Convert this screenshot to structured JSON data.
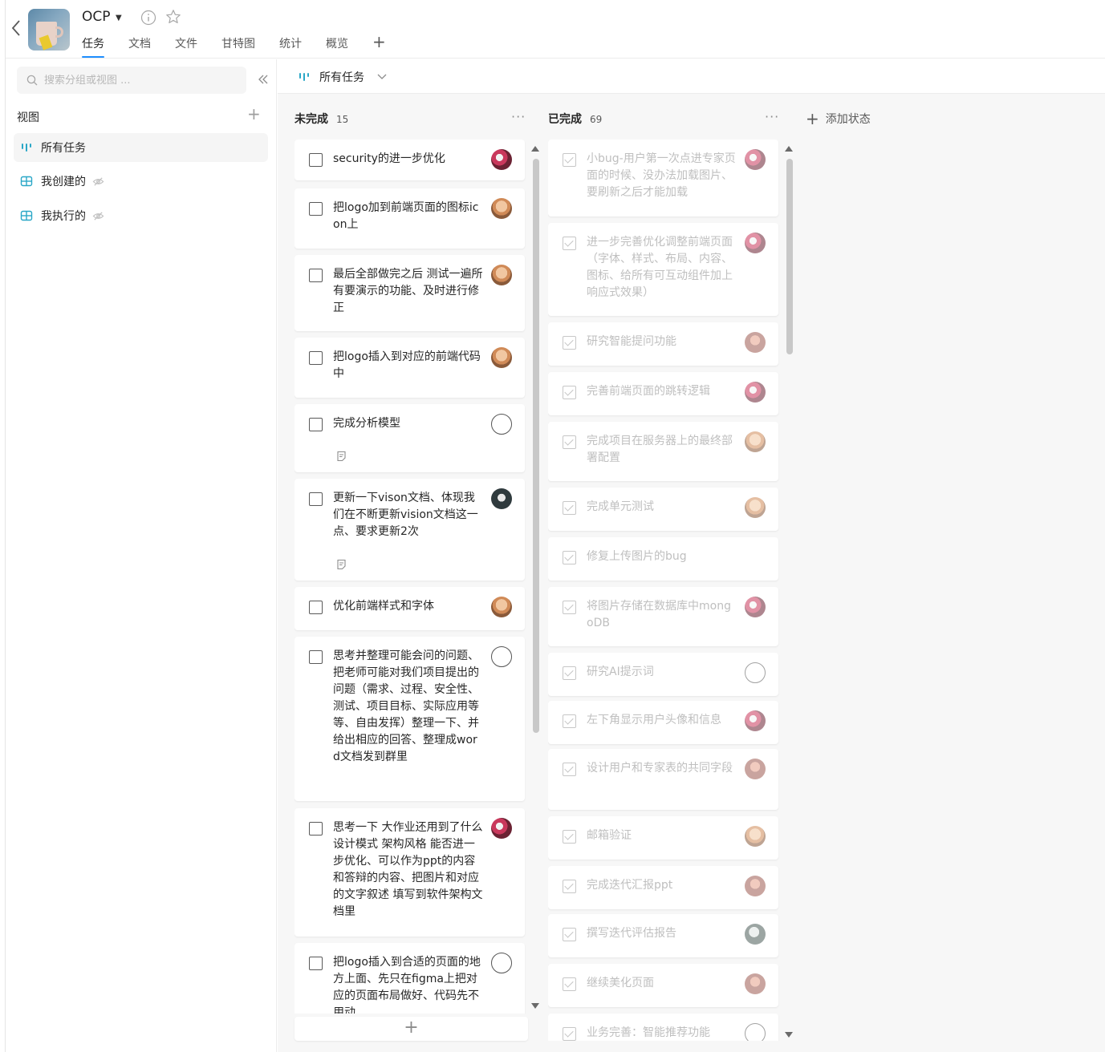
{
  "project": {
    "name": "OCP"
  },
  "tabs": [
    "任务",
    "文档",
    "文件",
    "甘特图",
    "统计",
    "概览"
  ],
  "sidebar": {
    "search_placeholder": "搜索分组或视图 ...",
    "views_title": "视图",
    "items": [
      {
        "label": "所有任务",
        "icon": "board-view-icon",
        "active": true
      },
      {
        "label": "我创建的",
        "icon": "table-view-icon",
        "hidden": true
      },
      {
        "label": "我执行的",
        "icon": "table-view-icon",
        "hidden": true
      }
    ]
  },
  "viewbar": {
    "current": "所有任务"
  },
  "columns": [
    {
      "name": "未完成",
      "count": "15",
      "cards": [
        {
          "title": "security的进一步优化",
          "avatar": "av-a"
        },
        {
          "title": "把logo加到前端页面的图标icon上",
          "avatar": "av-b"
        },
        {
          "title": "最后全部做完之后 测试一遍所有要演示的功能、及时进行修正",
          "avatar": "av-b"
        },
        {
          "title": "把logo插入到对应的前端代码中",
          "avatar": "av-b"
        },
        {
          "title": "完成分析模型",
          "avatar": "av-c",
          "note": true
        },
        {
          "title": "更新一下vison文档、体现我们在不断更新vision文档这一点、要求更新2次",
          "avatar": "av-d",
          "note": true
        },
        {
          "title": "优化前端样式和字体",
          "avatar": "av-b"
        },
        {
          "title": "思考并整理可能会问的问题、把老师可能对我们项目提出的问题（需求、过程、安全性、测试、项目目标、实际应用等等、自由发挥）整理一下、并给出相应的回答、整理成word文档发到群里",
          "avatar": "av-c"
        },
        {
          "title": "思考一下 大作业还用到了什么设计模式 架构风格 能否进一步优化、可以作为ppt的内容和答辩的内容、把图片和对应的文字叙述 填写到软件架构文档里",
          "avatar": "av-a"
        },
        {
          "title": "把logo插入到合适的页面的地方上面、先只在figma上把对应的页面布局做好、代码先不用动",
          "avatar": "av-c"
        }
      ]
    },
    {
      "name": "已完成",
      "count": "69",
      "cards": [
        {
          "title": "小bug-用户第一次点进专家页面的时候、没办法加载图片、要刷新之后才能加载",
          "avatar": "av-a"
        },
        {
          "title": "进一步完善优化调整前端页面（字体、样式、布局、内容、图标、给所有可互动组件加上响应式效果）",
          "avatar": "av-a"
        },
        {
          "title": "研究智能提问功能",
          "avatar": "av-e"
        },
        {
          "title": "完善前端页面的跳转逻辑",
          "avatar": "av-a"
        },
        {
          "title": "完成项目在服务器上的最终部署配置",
          "avatar": "av-b"
        },
        {
          "title": "完成单元测试",
          "avatar": "av-b"
        },
        {
          "title": "修复上传图片的bug",
          "avatar": ""
        },
        {
          "title": "将图片存储在数据库中mongoDB",
          "avatar": "av-a"
        },
        {
          "title": "研究AI提示词",
          "avatar": "av-c"
        },
        {
          "title": "左下角显示用户头像和信息",
          "avatar": "av-a"
        },
        {
          "title": "设计用户和专家表的共同字段",
          "avatar": "av-e"
        },
        {
          "title": "邮箱验证",
          "avatar": "av-b"
        },
        {
          "title": "完成迭代汇报ppt",
          "avatar": "av-e"
        },
        {
          "title": "撰写迭代评估报告",
          "avatar": "av-f"
        },
        {
          "title": "继续美化页面",
          "avatar": "av-e"
        },
        {
          "title": "业务完善：智能推荐功能",
          "avatar": "av-c"
        }
      ]
    }
  ],
  "add_status_label": "添加状态",
  "colors": {
    "accent": "#1e8eff",
    "view_icon": "#2aa7c7"
  }
}
